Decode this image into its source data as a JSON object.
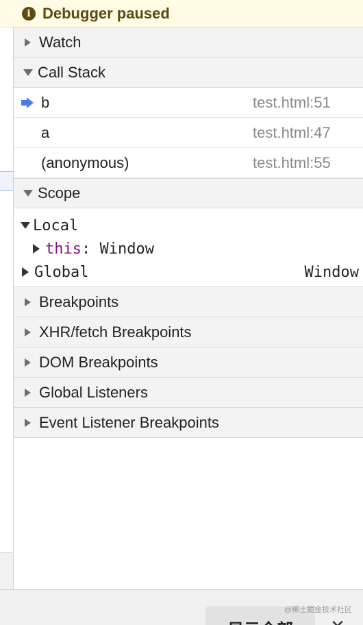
{
  "banner": {
    "text": "Debugger paused",
    "icon": "info-icon"
  },
  "sections": {
    "watch": "Watch",
    "call_stack": "Call Stack",
    "scope": "Scope",
    "breakpoints": "Breakpoints",
    "xhr_breakpoints": "XHR/fetch Breakpoints",
    "dom_breakpoints": "DOM Breakpoints",
    "global_listeners": "Global Listeners",
    "event_listener_breakpoints": "Event Listener Breakpoints"
  },
  "call_stack": [
    {
      "name": "b",
      "location": "test.html:51",
      "current": true
    },
    {
      "name": "a",
      "location": "test.html:47",
      "current": false
    },
    {
      "name": "(anonymous)",
      "location": "test.html:55",
      "current": false
    }
  ],
  "scope": {
    "local_label": "Local",
    "this_name": "this",
    "this_sep": ": ",
    "this_value": "Window",
    "global_label": "Global",
    "global_value": "Window"
  },
  "bottom": {
    "show_all_label": "显示全部",
    "close_glyph": "✕",
    "watermark": "@稀土掘金技术社区"
  },
  "colors": {
    "banner_bg": "#fffbe5",
    "banner_text": "#5c4a12",
    "current_frame_arrow": "#4a7be8",
    "property_name": "#881280"
  }
}
